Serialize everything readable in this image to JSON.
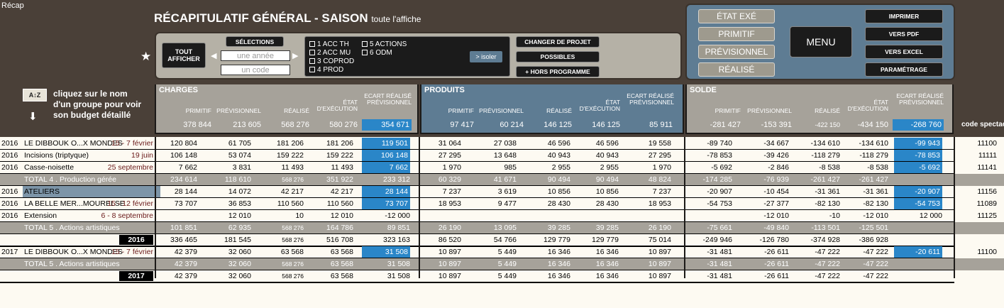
{
  "tab": "Récap",
  "title": {
    "main": "RÉCAPITULATIF GÉNÉRAL - SAISON",
    "sub": "toute l'affiche"
  },
  "controls": {
    "tout_afficher": "TOUT AFFICHER",
    "selections": "SÉLECTIONS",
    "annee_placeholder": "une année",
    "code_placeholder": "un code",
    "categories": [
      "1 ACC TH",
      "2 ACC MU",
      "3 COPROD",
      "4 PROD",
      "5 ACTIONS",
      "6 ODM"
    ],
    "isoler": "> isoler",
    "changer": "CHANGER DE PROJET",
    "possibles": "POSSIBLES",
    "hors": "+ HORS PROGRAMME"
  },
  "views": {
    "etat": "ÉTAT EXÉ",
    "primitif": "PRIMITIF",
    "previsionnel": "PRÉVISIONNEL",
    "realise": "RÉALISÉ"
  },
  "menu": "MENU",
  "actions": {
    "imprimer": "IMPRIMER",
    "pdf": "VERS PDF",
    "excel": "VERS EXCEL",
    "param": "PARAMÉTRAGE"
  },
  "hint": "cliquez sur le nom d'un groupe pour voir son budget détaillé",
  "sections": {
    "charges": "CHARGES",
    "produits": "PRODUITS",
    "solde": "SOLDE",
    "code": "code spectacle"
  },
  "cols": {
    "primitif": "PRIMITIF",
    "previsionnel": "PRÉVISIONNEL",
    "realise": "RÉALISÉ",
    "etat": "ÉTAT D'EXÉCUTION",
    "ecart": "ECART RÉALISÉ PRÉVISIONNEL"
  },
  "totals": {
    "charges": [
      "378 844",
      "213 605",
      "568 276",
      "580 276",
      "354 671"
    ],
    "produits": [
      "97 417",
      "60 214",
      "146 125",
      "146 125",
      "85 911"
    ],
    "solde": [
      "-281 427",
      "-153 391",
      "-422 150",
      "-434 150",
      "-268 760"
    ]
  },
  "rows": [
    {
      "t": "d",
      "year": "2016",
      "name": "LE DIBBOUK O...X MONDES",
      "dates": "15 - 7 février",
      "ch": [
        "120 804",
        "61 705",
        "181 206",
        "181 206",
        "119 501"
      ],
      "pr": [
        "31 064",
        "27 038",
        "46 596",
        "46 596",
        "19 558"
      ],
      "so": [
        "-89 740",
        "-34 667",
        "-134 610",
        "-134 610",
        "-99 943"
      ],
      "code": "11100",
      "hl": [
        true,
        true
      ]
    },
    {
      "t": "d",
      "year": "2016",
      "name": "Incisions (triptyque)",
      "dates": "19 juin",
      "ch": [
        "106 148",
        "53 074",
        "159 222",
        "159 222",
        "106 148"
      ],
      "pr": [
        "27 295",
        "13 648",
        "40 943",
        "40 943",
        "27 295"
      ],
      "so": [
        "-78 853",
        "-39 426",
        "-118 279",
        "-118 279",
        "-78 853"
      ],
      "code": "11111",
      "hl": [
        true,
        true
      ]
    },
    {
      "t": "d",
      "year": "2016",
      "name": "Casse-noisette",
      "dates": "25 septembre",
      "ch": [
        "7 662",
        "3 831",
        "11 493",
        "11 493",
        "7 662"
      ],
      "pr": [
        "1 970",
        "985",
        "2 955",
        "2 955",
        "1 970"
      ],
      "so": [
        "-5 692",
        "-2 846",
        "-8 538",
        "-8 538",
        "-5 692"
      ],
      "code": "11141",
      "hl": [
        true,
        true
      ]
    },
    {
      "t": "g",
      "name": "TOTAL 4 . Production gérée",
      "ch": [
        "234 614",
        "118 610",
        "568 276",
        "351 922",
        "233 312"
      ],
      "pr": [
        "60 329",
        "41 671",
        "90 494",
        "90 494",
        "48 824"
      ],
      "so": [
        "-174 285",
        "-76 939",
        "-261 427",
        "-261 427",
        ""
      ]
    },
    {
      "t": "d",
      "year": "2016",
      "name": "ATELIERS",
      "dates": "",
      "ch": [
        "28 144",
        "14 072",
        "42 217",
        "42 217",
        "28 144"
      ],
      "pr": [
        "7 237",
        "3 619",
        "10 856",
        "10 856",
        "7 237"
      ],
      "so": [
        "-20 907",
        "-10 454",
        "-31 361",
        "-31 361",
        "-20 907"
      ],
      "code": "11156",
      "hl": [
        true,
        true
      ],
      "sel": true
    },
    {
      "t": "d",
      "year": "2016",
      "name": "LA BELLE MER...MOURELSE",
      "dates": "15 - 12 février",
      "ch": [
        "73 707",
        "36 853",
        "110 560",
        "110 560",
        "73 707"
      ],
      "pr": [
        "18 953",
        "9 477",
        "28 430",
        "28 430",
        "18 953"
      ],
      "so": [
        "-54 753",
        "-27 377",
        "-82 130",
        "-82 130",
        "-54 753"
      ],
      "code": "11089",
      "hl": [
        true,
        true
      ]
    },
    {
      "t": "d",
      "year": "2016",
      "name": "Extension",
      "dates": "6 - 8 septembre",
      "ch": [
        "",
        "12 010",
        "10",
        "12 010",
        "-12 000"
      ],
      "pr": [
        "",
        "",
        "",
        "",
        ""
      ],
      "so": [
        "",
        "-12 010",
        "-10",
        "-12 010",
        "12 000"
      ],
      "code": "11125",
      "hl": [
        false,
        false
      ]
    },
    {
      "t": "g",
      "name": "TOTAL 5 . Actions artistiques",
      "ch": [
        "101 851",
        "62 935",
        "568 276",
        "164 786",
        "89 851"
      ],
      "pr": [
        "26 190",
        "13 095",
        "39 285",
        "39 285",
        "26 190"
      ],
      "so": [
        "-75 661",
        "-49 840",
        "-113 501",
        "-125 501",
        ""
      ]
    },
    {
      "t": "y",
      "label": "2016",
      "ch": [
        "336 465",
        "181 545",
        "568 276",
        "516 708",
        "323 163"
      ],
      "pr": [
        "86 520",
        "54 766",
        "129 779",
        "129 779",
        "75 014"
      ],
      "so": [
        "-249 946",
        "-126 780",
        "-374 928",
        "-386 928",
        ""
      ]
    },
    {
      "t": "d",
      "year": "2017",
      "name": "LE DIBBOUK O...X MONDES",
      "dates": "15 - 7 février",
      "ch": [
        "42 379",
        "32 060",
        "63 568",
        "63 568",
        "31 508"
      ],
      "pr": [
        "10 897",
        "5 449",
        "16 346",
        "16 346",
        "10 897"
      ],
      "so": [
        "-31 481",
        "-26 611",
        "-47 222",
        "-47 222",
        "-20 611"
      ],
      "code": "11100",
      "hl": [
        true,
        true
      ]
    },
    {
      "t": "g",
      "name": "TOTAL 5 . Actions artistiques",
      "ch": [
        "42 379",
        "32 060",
        "568 276",
        "63 568",
        "31 508"
      ],
      "pr": [
        "10 897",
        "5 449",
        "16 346",
        "16 346",
        "10 897"
      ],
      "so": [
        "-31 481",
        "-26 611",
        "-47 222",
        "-47 222",
        ""
      ]
    },
    {
      "t": "y",
      "label": "2017",
      "ch": [
        "42 379",
        "32 060",
        "568 276",
        "63 568",
        "31 508"
      ],
      "pr": [
        "10 897",
        "5 449",
        "16 346",
        "16 346",
        "10 897"
      ],
      "so": [
        "-31 481",
        "-26 611",
        "-47 222",
        "-47 222",
        ""
      ]
    }
  ]
}
